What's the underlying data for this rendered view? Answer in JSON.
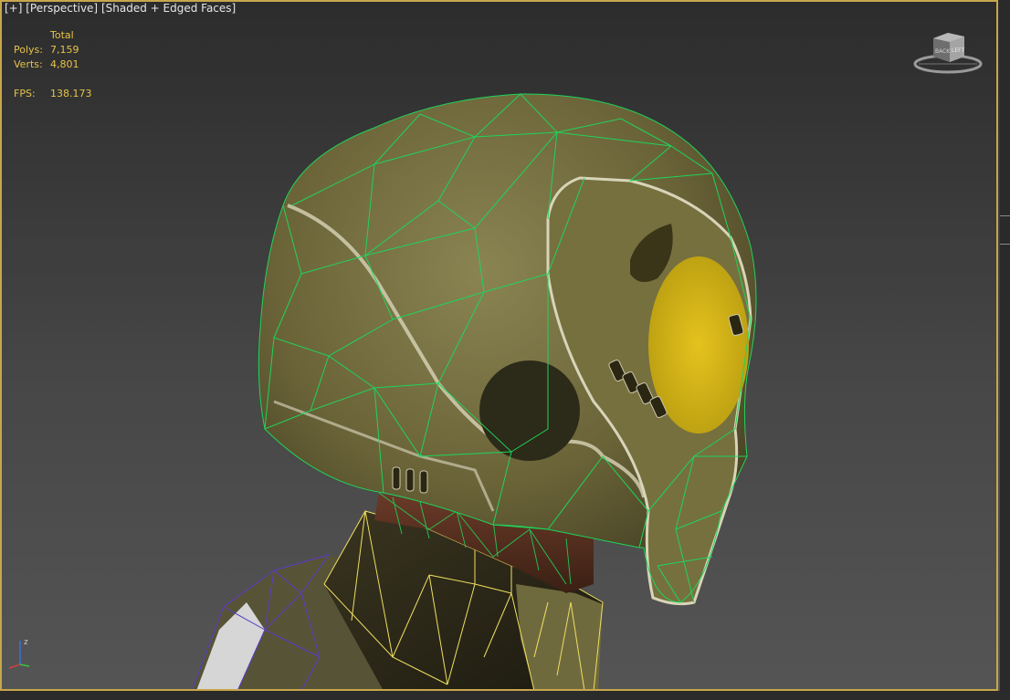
{
  "viewport": {
    "plus_label": "[+]",
    "view_label": "[Perspective]",
    "shading_label": "[Shaded + Edged Faces]"
  },
  "stats": {
    "header": "Total",
    "polys_label": "Polys:",
    "polys_value": "7,159",
    "verts_label": "Verts:",
    "verts_value": "4,801",
    "fps_label": "FPS:",
    "fps_value": "138.173"
  },
  "viewcube": {
    "face_front": "LEFT",
    "face_side": "BACK",
    "icon": "viewcube-icon"
  },
  "axis": {
    "z_label": "z",
    "icon": "axis-tripod-icon"
  },
  "colors": {
    "stats_text": "#e6c34a",
    "viewport_border": "#c8a64a",
    "wire_helmet": "#1fd45a",
    "wire_neck": "#f0e060",
    "wire_body": "#5a3cc8",
    "decal": "#d8b818"
  }
}
